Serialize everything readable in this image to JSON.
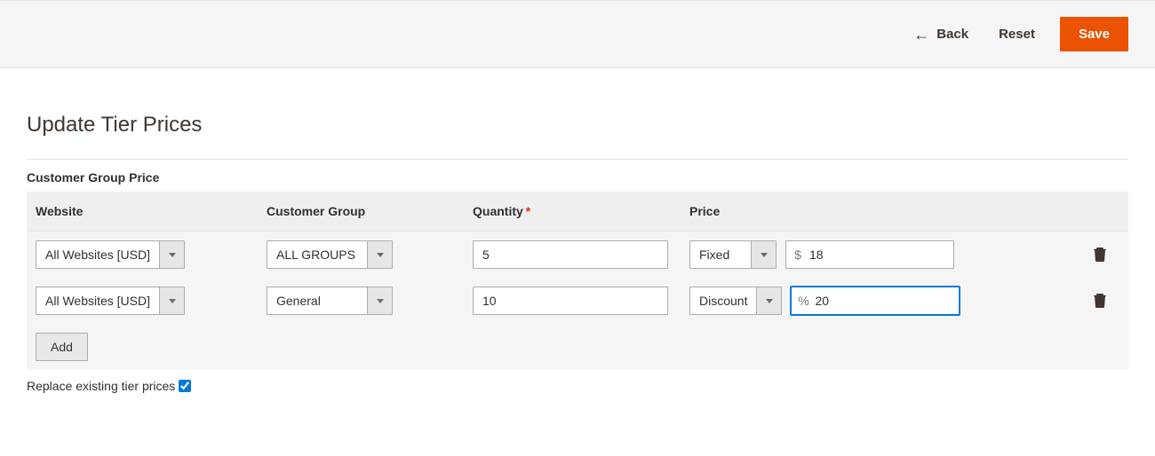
{
  "header": {
    "back_label": "Back",
    "reset_label": "Reset",
    "save_label": "Save"
  },
  "page": {
    "title": "Update Tier Prices",
    "section_label": "Customer Group Price"
  },
  "columns": {
    "website": "Website",
    "customer_group": "Customer Group",
    "quantity": "Quantity",
    "price": "Price"
  },
  "rows": [
    {
      "website": "All Websites [USD]",
      "customer_group": "ALL GROUPS",
      "quantity": "5",
      "price_type": "Fixed",
      "price_prefix": "$",
      "price_value": "18",
      "focused": false
    },
    {
      "website": "All Websites [USD]",
      "customer_group": "General",
      "quantity": "10",
      "price_type": "Discount",
      "price_prefix": "%",
      "price_value": "20",
      "focused": true
    }
  ],
  "buttons": {
    "add_label": "Add"
  },
  "replace": {
    "label": "Replace existing tier prices",
    "checked": true
  }
}
